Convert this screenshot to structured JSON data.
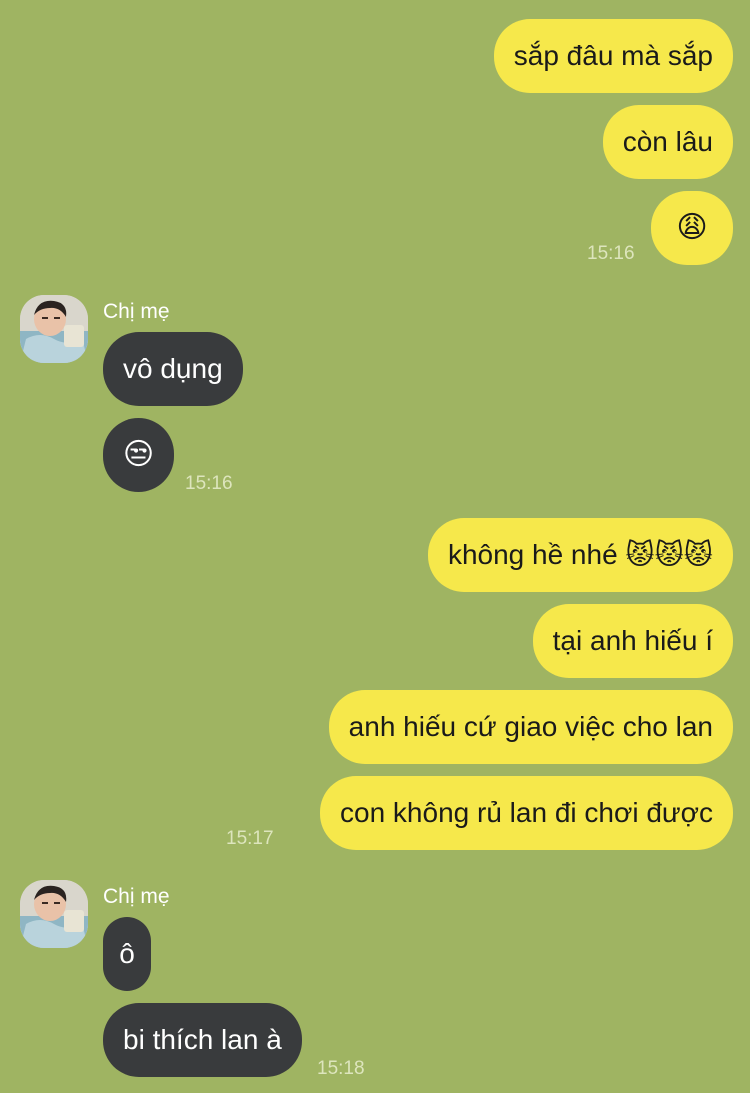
{
  "contact": {
    "name": "Chị mẹ"
  },
  "messages": {
    "m1": "sắp đâu mà sắp",
    "m2": "còn lâu",
    "m3": "😩",
    "m4": "vô dụng",
    "m5": "😒",
    "m6": "không hề nhé 😾😾😾",
    "m7": "tại anh hiếu í",
    "m8": "anh hiếu cứ giao việc cho lan",
    "m9": "con không rủ lan đi chơi được",
    "m10": "ô",
    "m11": "bi thích lan à"
  },
  "times": {
    "t1": "15:16",
    "t2": "15:16",
    "t3": "15:17",
    "t4": "15:18"
  },
  "colors": {
    "background": "#9fb462",
    "outgoing_bubble": "#f6e84b",
    "incoming_bubble": "#393b3d"
  }
}
